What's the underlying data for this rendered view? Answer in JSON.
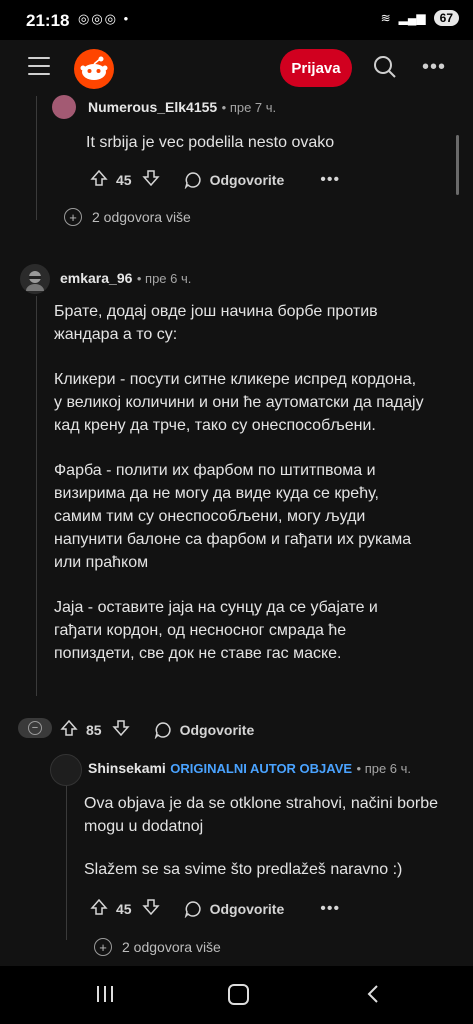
{
  "status_bar": {
    "time": "21:18",
    "battery": "67"
  },
  "header": {
    "login_label": "Prijava"
  },
  "comments": [
    {
      "username": "Numerous_Elk4155",
      "time": "пре 7 ч.",
      "text": "It srbija je vec podelila nesto ovako",
      "votes": "45",
      "reply_label": "Odgovorite",
      "more_replies": "2 odgovora više"
    },
    {
      "username": "emkara_96",
      "time": "пре 6 ч.",
      "paragraphs": [
        "Брате, додај овде још начина борбе против жандара а то су:",
        "Кликери - посути ситне кликере испред кордона, у великој количини и они ће аутоматски да падају кад крену да трче, тако су онеспособљени.",
        "Фарба - полити их фарбом по штитпвома и визирима да не могу да виде куда се крећу, самим тим су онеспособљени, могу људи напунити балоне са фарбом и гађати их рукама или праћком",
        "Јаја - оставите јаја на сунцу да се убајате и гађати кордон, од несносног смрада ће попиздети, све док не ставе гас маске."
      ],
      "votes": "85",
      "reply_label": "Odgovorite"
    },
    {
      "username": "Shinsekami",
      "badge": "ORIGINALNI AUTOR OBJAVE",
      "time": "пре 6 ч.",
      "paragraphs": [
        "Ova objava je da se otklone strahovi, načini borbe mogu u dodatnoj",
        "Slažem se sa svime što predlažeš naravno :)"
      ],
      "votes": "45",
      "reply_label": "Odgovorite",
      "more_replies": "2 odgovora više"
    }
  ],
  "colors": {
    "accent": "#d1001f",
    "op_badge": "#4aa3ff",
    "background": "#121212"
  }
}
